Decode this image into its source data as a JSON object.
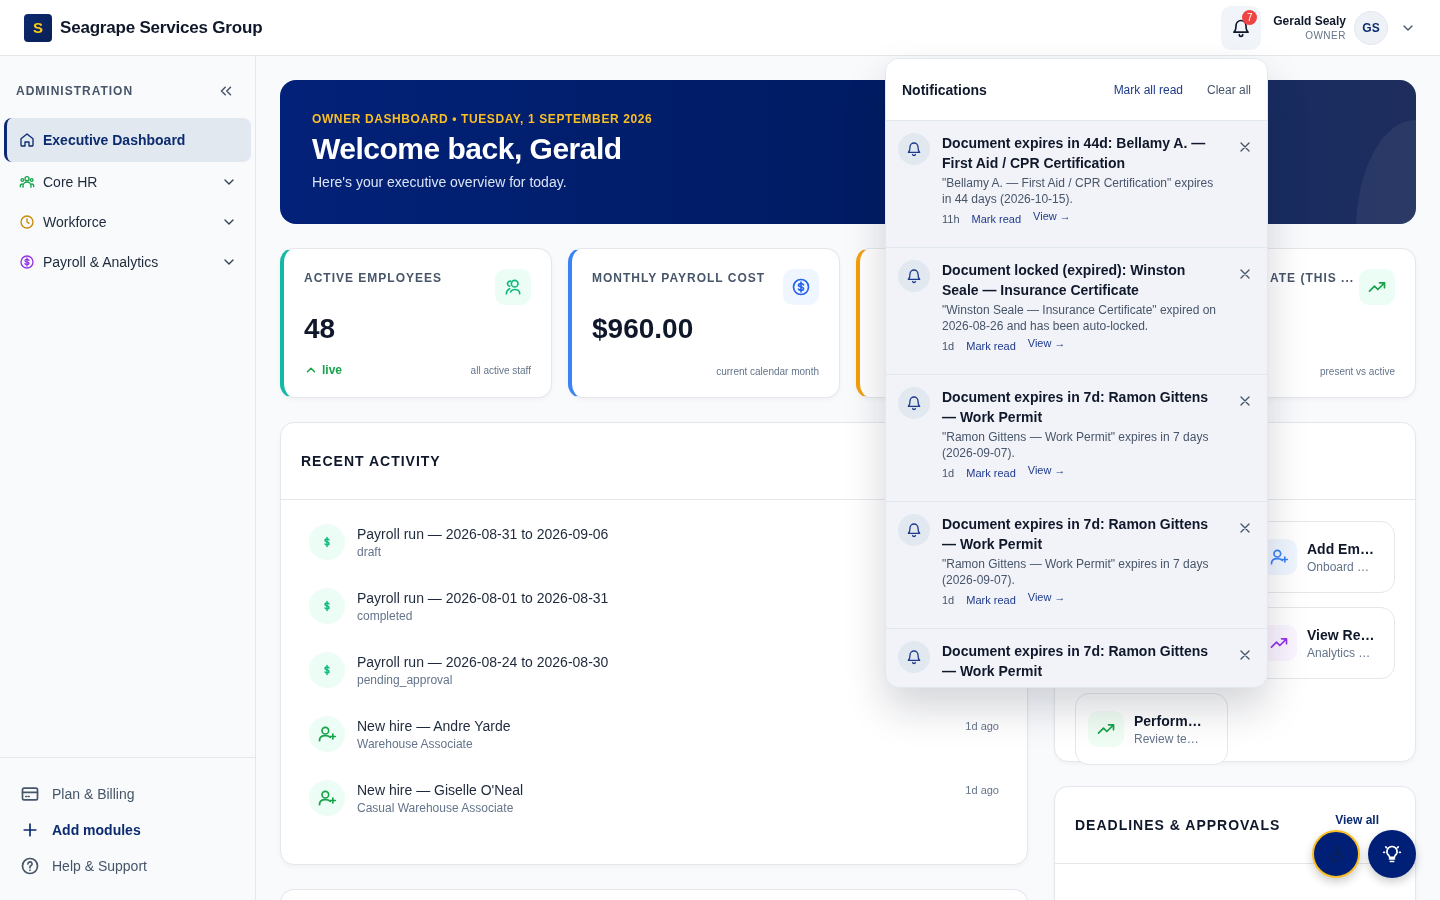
{
  "brand": {
    "logo": "S",
    "name": "Seagrape Services Group"
  },
  "header": {
    "notification_count": "7",
    "user": {
      "name": "Gerald Sealy",
      "role": "OWNER",
      "initials": "GS"
    }
  },
  "sidebar": {
    "section": "ADMINISTRATION",
    "items": [
      {
        "label": "Executive Dashboard",
        "selected": true,
        "expandable": false
      },
      {
        "label": "Core HR",
        "selected": false,
        "expandable": true
      },
      {
        "label": "Workforce",
        "selected": false,
        "expandable": true
      },
      {
        "label": "Payroll & Analytics",
        "selected": false,
        "expandable": true
      }
    ],
    "footer": [
      {
        "label": "Plan & Billing",
        "kind": "link"
      },
      {
        "label": "Add modules",
        "kind": "action"
      },
      {
        "label": "Help & Support",
        "kind": "link"
      }
    ]
  },
  "banner": {
    "eyebrow": "OWNER DASHBOARD • TUESDAY, 1 SEPTEMBER 2026",
    "title": "Welcome back, Gerald",
    "subtitle": "Here's your executive overview for today."
  },
  "kpis": [
    {
      "kind": "full",
      "label": "ACTIVE EMPLOYEES",
      "value": "48",
      "trend": "live",
      "note": "all active staff",
      "color": "#14b8a6"
    },
    {
      "kind": "full",
      "label": "MONTHLY PAYROLL COST",
      "value": "$960.00",
      "note": "current calendar month",
      "color": "#3b82f6"
    },
    {
      "kind": "hidden",
      "color": "#f59e0b"
    },
    {
      "kind": "partial",
      "label": "ATE (THIS ...",
      "note": "present vs active"
    }
  ],
  "recent_activity": {
    "title": "RECENT ACTIVITY",
    "items": [
      {
        "kind": "payroll",
        "title": "Payroll run — 2026-08-31 to 2026-09-06",
        "subtitle": "draft"
      },
      {
        "kind": "payroll",
        "title": "Payroll run — 2026-08-01 to 2026-08-31",
        "subtitle": "completed"
      },
      {
        "kind": "payroll",
        "title": "Payroll run — 2026-08-24 to 2026-08-30",
        "subtitle": "pending_approval"
      },
      {
        "kind": "hire",
        "title": "New hire — Andre Yarde",
        "subtitle": "Warehouse Associate",
        "time": "1d ago"
      },
      {
        "kind": "hire",
        "title": "New hire — Giselle O'Neal",
        "subtitle": "Casual Warehouse Associate",
        "time": "1d ago"
      }
    ]
  },
  "quick_actions": {
    "actions": [
      {
        "kind": "add",
        "title": "Add Em…",
        "subtitle": "Onboard …"
      },
      {
        "kind": "report",
        "title": "View Re…",
        "subtitle": "Analytics …"
      },
      {
        "kind": "performance",
        "title": "Perform…",
        "subtitle": "Review te…"
      }
    ]
  },
  "deadlines": {
    "title": "DEADLINES & APPROVALS",
    "link": "View all"
  },
  "notifications": {
    "title": "Notifications",
    "mark_all": "Mark all read",
    "clear_all": "Clear all",
    "items": [
      {
        "title": "Document expires in 44d: Bellamy A. — First Aid / CPR Certification",
        "body": "\"Bellamy A. — First Aid / CPR Certification\" expires in 44 days (2026-10-15).",
        "time": "11h",
        "mark_read": "Mark read",
        "view": "View →"
      },
      {
        "title": "Document locked (expired): Winston Seale — Insurance Certificate",
        "body": "\"Winston Seale — Insurance Certificate\" expired on 2026-08-26 and has been auto-locked.",
        "time": "1d",
        "mark_read": "Mark read",
        "view": "View →"
      },
      {
        "title": "Document expires in 7d: Ramon Gittens — Work Permit",
        "body": "\"Ramon Gittens — Work Permit\" expires in 7 days (2026-09-07).",
        "time": "1d",
        "mark_read": "Mark read",
        "view": "View →"
      },
      {
        "title": "Document expires in 7d: Ramon Gittens — Work Permit",
        "body": "\"Ramon Gittens — Work Permit\" expires in 7 days (2026-09-07).",
        "time": "1d",
        "mark_read": "Mark read",
        "view": "View →"
      },
      {
        "title": "Document expires in 7d: Ramon Gittens — Work Permit"
      }
    ]
  }
}
